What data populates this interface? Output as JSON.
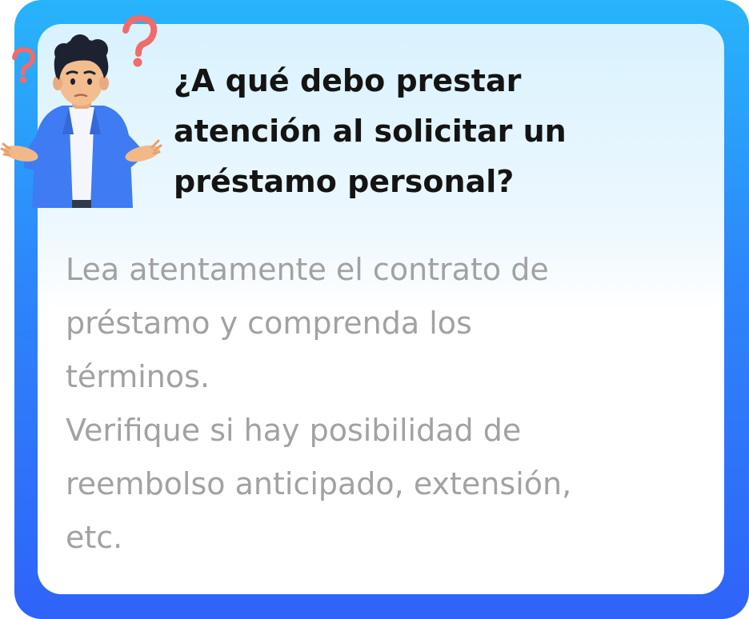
{
  "card": {
    "title": "¿A qué debo prestar\natención al solicitar un\npréstamo personal?",
    "body": "Lea atentamente el contrato de\npréstamo y comprenda los\ntérminos.\nVerifique si hay posibilidad de\nreembolso anticipado, extensión,\netc."
  },
  "illustration": {
    "name": "confused-person-shrugging",
    "icon": "question-mark-icon"
  },
  "colors": {
    "frame_top": "#27b4fb",
    "frame_bottom": "#2f63f9",
    "inner_top": "#d9f2fe",
    "title_text": "#141414",
    "body_text": "#a2a2a2",
    "question_mark": "#f06b6b",
    "jacket": "#3f7bf2"
  }
}
